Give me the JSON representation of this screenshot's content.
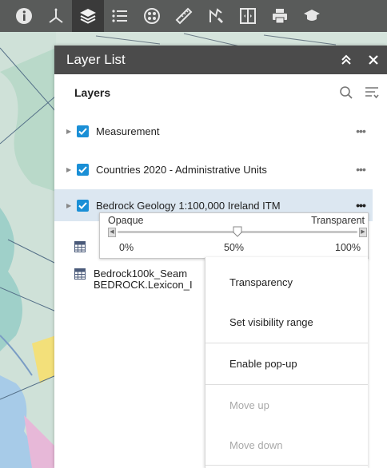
{
  "toolbar": {
    "buttons": [
      {
        "icon": "info-icon"
      },
      {
        "icon": "coordinate-axis-icon"
      },
      {
        "icon": "layers-icon",
        "active": true
      },
      {
        "icon": "legend-list-icon"
      },
      {
        "icon": "basemap-gallery-icon"
      },
      {
        "icon": "measure-ruler-icon"
      },
      {
        "icon": "draw-icon"
      },
      {
        "icon": "swipe-icon"
      },
      {
        "icon": "print-icon"
      },
      {
        "icon": "education-cap-icon"
      }
    ]
  },
  "panel": {
    "title": "Layer List",
    "layers_label": "Layers",
    "layers": [
      {
        "label": "Measurement",
        "checked": true
      },
      {
        "label": "Countries 2020 - Administrative Units",
        "checked": true
      },
      {
        "label": "Bedrock Geology 1:100,000 Ireland ITM",
        "checked": true,
        "selected": true
      }
    ],
    "tables": [
      {
        "line1": "",
        "line2": ""
      },
      {
        "line1": "Bedrock100k_Seam",
        "line2": "BEDROCK.Lexicon_I"
      }
    ],
    "more_dots": "•••"
  },
  "slider": {
    "left_label": "Opaque",
    "right_label": "Transparent",
    "ticks": [
      "0%",
      "50%",
      "100%"
    ],
    "value_percent": 50
  },
  "menu": {
    "items": [
      {
        "label": "Transparency",
        "enabled": true
      },
      {
        "label": "Set visibility range",
        "enabled": true
      },
      {
        "label": "Enable pop-up",
        "enabled": true
      },
      {
        "label": "Move up",
        "enabled": false
      },
      {
        "label": "Move down",
        "enabled": false
      }
    ]
  },
  "colors": {
    "accent": "#1a8fd6",
    "header": "#4b4b4b",
    "selected_row": "#dce7f1"
  }
}
